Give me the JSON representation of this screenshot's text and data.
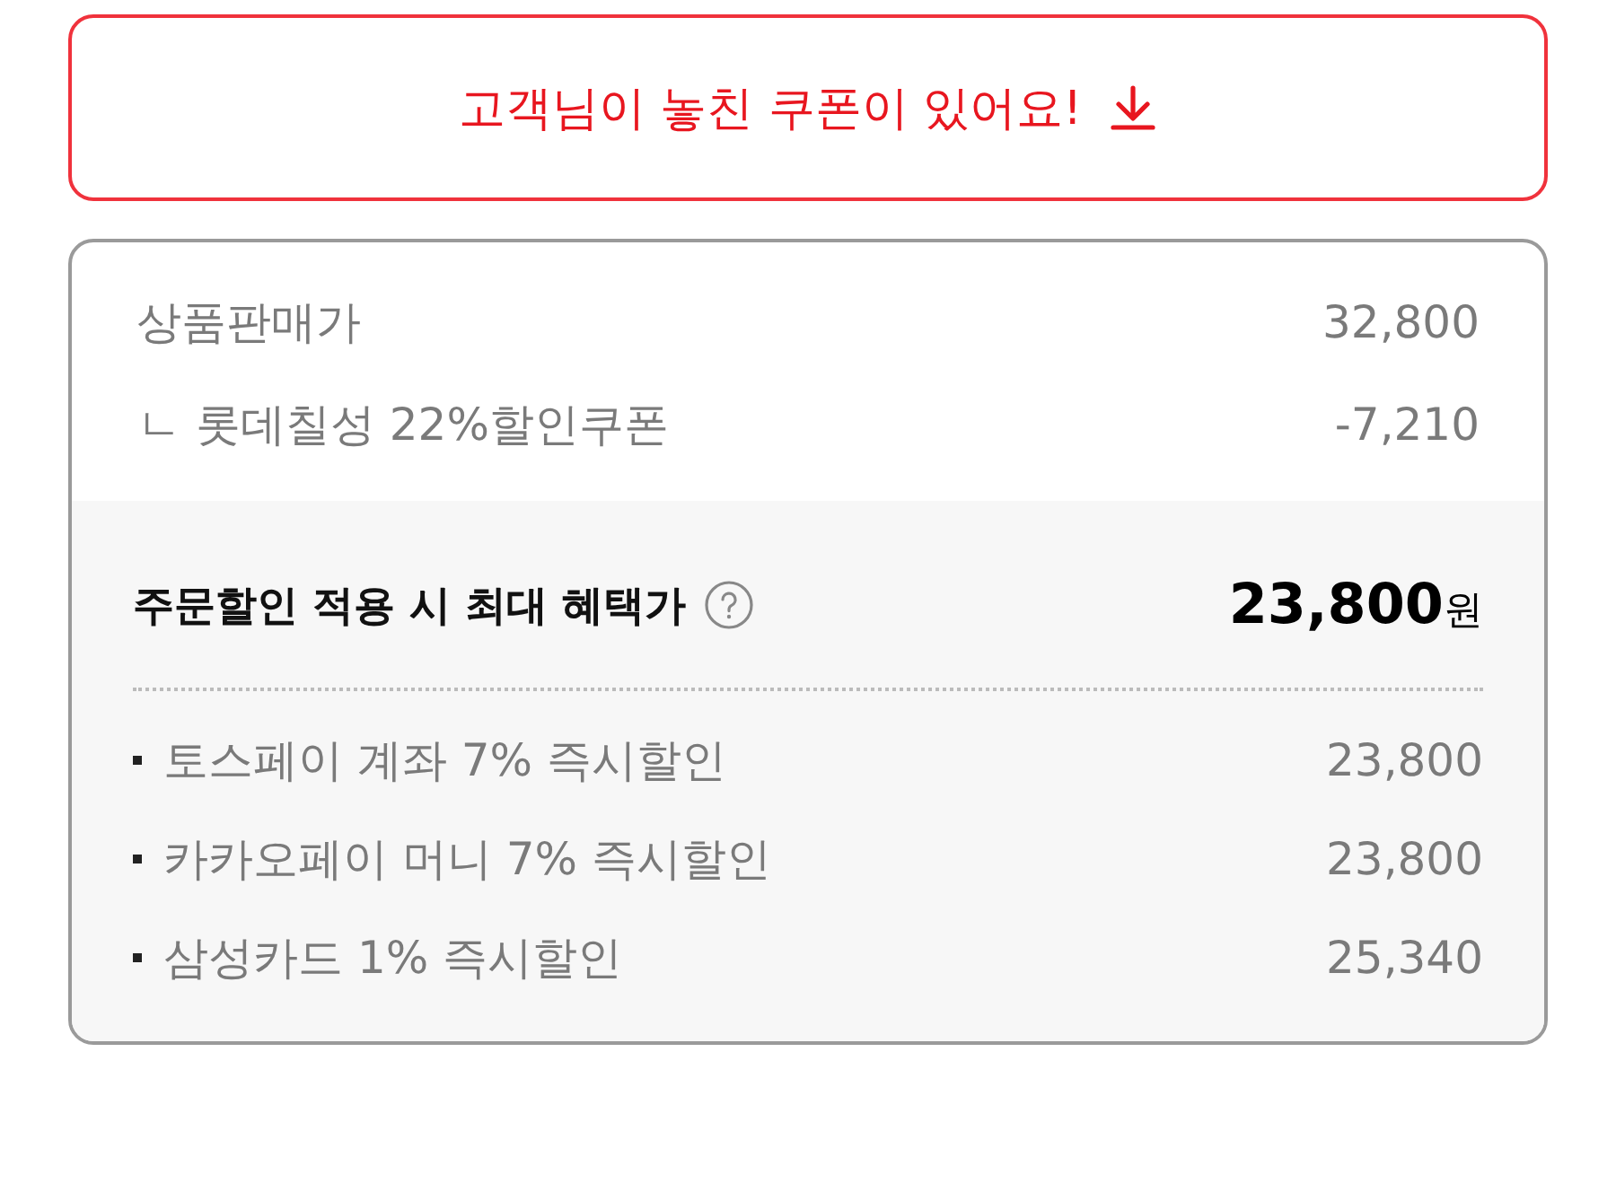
{
  "coupon_banner": {
    "label": "고객님이 놓친 쿠폰이 있어요!"
  },
  "price_summary": {
    "rows": [
      {
        "label": "상품판매가",
        "value": "32,800"
      },
      {
        "label": "ㄴ 롯데칠성 22%할인쿠폰",
        "value": "-7,210"
      }
    ]
  },
  "max_benefit": {
    "title": "주문할인 적용 시 최대 혜택가",
    "price": "23,800",
    "unit": "원",
    "items": [
      {
        "label": "토스페이 계좌 7% 즉시할인",
        "value": "23,800"
      },
      {
        "label": "카카오페이 머니 7% 즉시할인",
        "value": "23,800"
      },
      {
        "label": "삼성카드 1% 즉시할인",
        "value": "25,340"
      }
    ]
  }
}
